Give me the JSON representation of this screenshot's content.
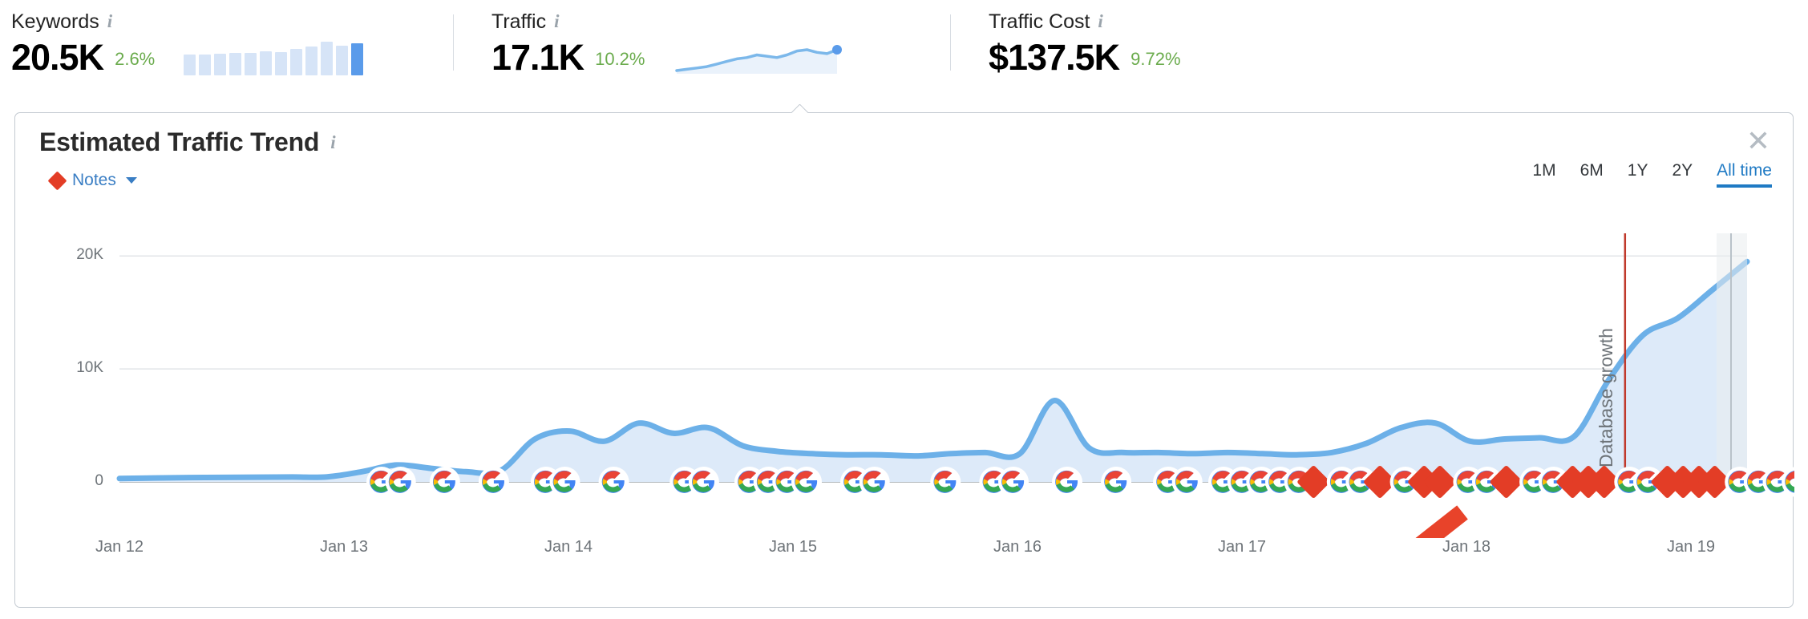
{
  "metrics": [
    {
      "id": "keywords",
      "label": "Keywords",
      "info_icon": "info-icon",
      "value": "20.5K",
      "delta": "2.6%",
      "delta_color": "#6aab4c",
      "sparkline_type": "bars",
      "bars": [
        22,
        22,
        23,
        24,
        24,
        26,
        25,
        28,
        31,
        36,
        32,
        34
      ],
      "bar_color": "#d6e4f7",
      "bar_active_color": "#5a9bea"
    },
    {
      "id": "traffic",
      "label": "Traffic",
      "info_icon": "info-icon",
      "value": "17.1K",
      "delta": "10.2%",
      "delta_color": "#6aab4c",
      "sparkline_type": "line",
      "points": [
        10,
        11,
        12,
        13,
        15,
        17,
        19,
        20,
        22,
        21,
        20,
        22,
        25,
        26,
        24,
        23,
        26
      ],
      "line_color": "#7cb8ea",
      "fill_color": "#eaf2fb",
      "end_dot_color": "#5a9bea"
    },
    {
      "id": "traffic-cost",
      "label": "Traffic Cost",
      "info_icon": "info-icon",
      "value": "$137.5K",
      "delta": "9.72%",
      "delta_color": "#6aab4c",
      "sparkline_type": "none"
    }
  ],
  "card": {
    "title": "Estimated Traffic Trend",
    "info_icon": "info-icon",
    "close_icon": "close-icon",
    "notes": {
      "label": "Notes",
      "marker_color": "#e33d26",
      "caret_icon": "chevron-down-icon"
    },
    "range_tabs": [
      {
        "label": "1M",
        "active": false
      },
      {
        "label": "6M",
        "active": false
      },
      {
        "label": "1Y",
        "active": false
      },
      {
        "label": "2Y",
        "active": false
      },
      {
        "label": "All time",
        "active": true
      }
    ],
    "accent_color": "#1f7ac4"
  },
  "chart_data": {
    "type": "area",
    "title": "Estimated Traffic Trend",
    "xlabel": "",
    "ylabel": "",
    "ylim": [
      0,
      22000
    ],
    "yticks": [
      "0",
      "10K",
      "20K"
    ],
    "ytick_values": [
      0,
      10000,
      20000
    ],
    "grid": true,
    "legend": "none",
    "line_color": "#6cb0e8",
    "fill_color": "#ddeaf9",
    "xticks": [
      "Jan 12",
      "Jan 13",
      "Jan 14",
      "Jan 15",
      "Jan 16",
      "Jan 17",
      "Jan 18",
      "Jan 19"
    ],
    "x": [
      "Jan 12",
      "Jan 12",
      "Jan 12",
      "Jan 12",
      "Jan 12",
      "Jan 12",
      "Jan 13",
      "Jan 13",
      "Jan 13",
      "Jan 13",
      "Jan 13",
      "Jan 13",
      "Jan 14",
      "Jan 14",
      "Jan 14",
      "Jan 14",
      "Jan 14",
      "Jan 14",
      "Jan 15",
      "Jan 15",
      "Jan 15",
      "Jan 15",
      "Jan 15",
      "Jan 15",
      "Jan 16",
      "Jan 16",
      "Jan 16",
      "Jan 16",
      "Jan 16",
      "Jan 16",
      "Jan 17",
      "Jan 17",
      "Jan 17",
      "Jan 17",
      "Jan 17",
      "Jan 17",
      "Jan 18",
      "Jan 18",
      "Jan 18",
      "Jan 18",
      "Jan 18",
      "Jan 18",
      "Jan 19",
      "Jan 19",
      "Jan 19",
      "Jan 19",
      "Jan 19",
      "Jan 19"
    ],
    "values": [
      300,
      350,
      380,
      400,
      420,
      430,
      450,
      900,
      1500,
      1200,
      900,
      1000,
      3800,
      4500,
      3600,
      5200,
      4300,
      4800,
      3200,
      2700,
      2500,
      2400,
      2400,
      2300,
      2500,
      2600,
      2500,
      7200,
      3000,
      2600,
      2600,
      2500,
      2600,
      2500,
      2400,
      2600,
      3400,
      4800,
      5200,
      3600,
      3800,
      3900,
      4000,
      9000,
      13000,
      14500,
      17000,
      19500
    ],
    "annotations": [
      {
        "id": "database-growth",
        "text": "Database growth",
        "orientation": "vertical",
        "line_color": "#c0392b",
        "x_position_pct": 92.5
      },
      {
        "id": "growth-arrow",
        "type": "arrow",
        "color": "#e8432a",
        "direction": "up-right"
      }
    ],
    "note_markers": {
      "google_update_icon": "google-g-icon",
      "user_note_icon": "red-diamond-icon",
      "google_color_blue": "#4285f4",
      "google_color_red": "#ea4335",
      "google_color_yellow": "#fbbc05",
      "google_color_green": "#34a853",
      "note_color": "#e33d26",
      "markers": [
        {
          "pct": 16.6,
          "type": "g"
        },
        {
          "pct": 17.8,
          "type": "g"
        },
        {
          "pct": 20.6,
          "type": "g"
        },
        {
          "pct": 23.7,
          "type": "g"
        },
        {
          "pct": 27.0,
          "type": "g"
        },
        {
          "pct": 28.2,
          "type": "g"
        },
        {
          "pct": 31.3,
          "type": "g"
        },
        {
          "pct": 35.8,
          "type": "g"
        },
        {
          "pct": 37.0,
          "type": "g"
        },
        {
          "pct": 39.9,
          "type": "g"
        },
        {
          "pct": 41.1,
          "type": "g"
        },
        {
          "pct": 42.3,
          "type": "g"
        },
        {
          "pct": 43.5,
          "type": "g"
        },
        {
          "pct": 46.6,
          "type": "g"
        },
        {
          "pct": 47.8,
          "type": "g"
        },
        {
          "pct": 52.3,
          "type": "g"
        },
        {
          "pct": 55.4,
          "type": "g"
        },
        {
          "pct": 56.6,
          "type": "g"
        },
        {
          "pct": 60.0,
          "type": "g"
        },
        {
          "pct": 63.1,
          "type": "g"
        },
        {
          "pct": 66.4,
          "type": "g"
        },
        {
          "pct": 67.6,
          "type": "g"
        },
        {
          "pct": 69.9,
          "type": "g"
        },
        {
          "pct": 71.1,
          "type": "g"
        },
        {
          "pct": 72.3,
          "type": "g"
        },
        {
          "pct": 73.5,
          "type": "g"
        },
        {
          "pct": 74.7,
          "type": "g"
        },
        {
          "pct": 75.6,
          "type": "d"
        },
        {
          "pct": 77.4,
          "type": "g"
        },
        {
          "pct": 78.6,
          "type": "g"
        },
        {
          "pct": 79.8,
          "type": "d"
        },
        {
          "pct": 81.4,
          "type": "g"
        },
        {
          "pct": 82.6,
          "type": "d"
        },
        {
          "pct": 83.6,
          "type": "d"
        },
        {
          "pct": 85.4,
          "type": "g"
        },
        {
          "pct": 86.6,
          "type": "g"
        },
        {
          "pct": 87.8,
          "type": "d"
        },
        {
          "pct": 89.6,
          "type": "g"
        },
        {
          "pct": 90.8,
          "type": "g"
        },
        {
          "pct": 92.0,
          "type": "d"
        },
        {
          "pct": 93.0,
          "type": "d"
        },
        {
          "pct": 94.0,
          "type": "d"
        },
        {
          "pct": 95.6,
          "type": "g"
        },
        {
          "pct": 96.8,
          "type": "g"
        },
        {
          "pct": 98.0,
          "type": "d"
        },
        {
          "pct": 99.0,
          "type": "d"
        },
        {
          "pct": 100.0,
          "type": "d"
        },
        {
          "pct": 101.0,
          "type": "d"
        },
        {
          "pct": 102.6,
          "type": "g"
        },
        {
          "pct": 103.8,
          "type": "g"
        },
        {
          "pct": 105.0,
          "type": "g"
        },
        {
          "pct": 106.2,
          "type": "g"
        },
        {
          "pct": 107.4,
          "type": "g"
        },
        {
          "pct": 108.6,
          "type": "g"
        },
        {
          "pct": 109.8,
          "type": "g"
        }
      ]
    }
  }
}
